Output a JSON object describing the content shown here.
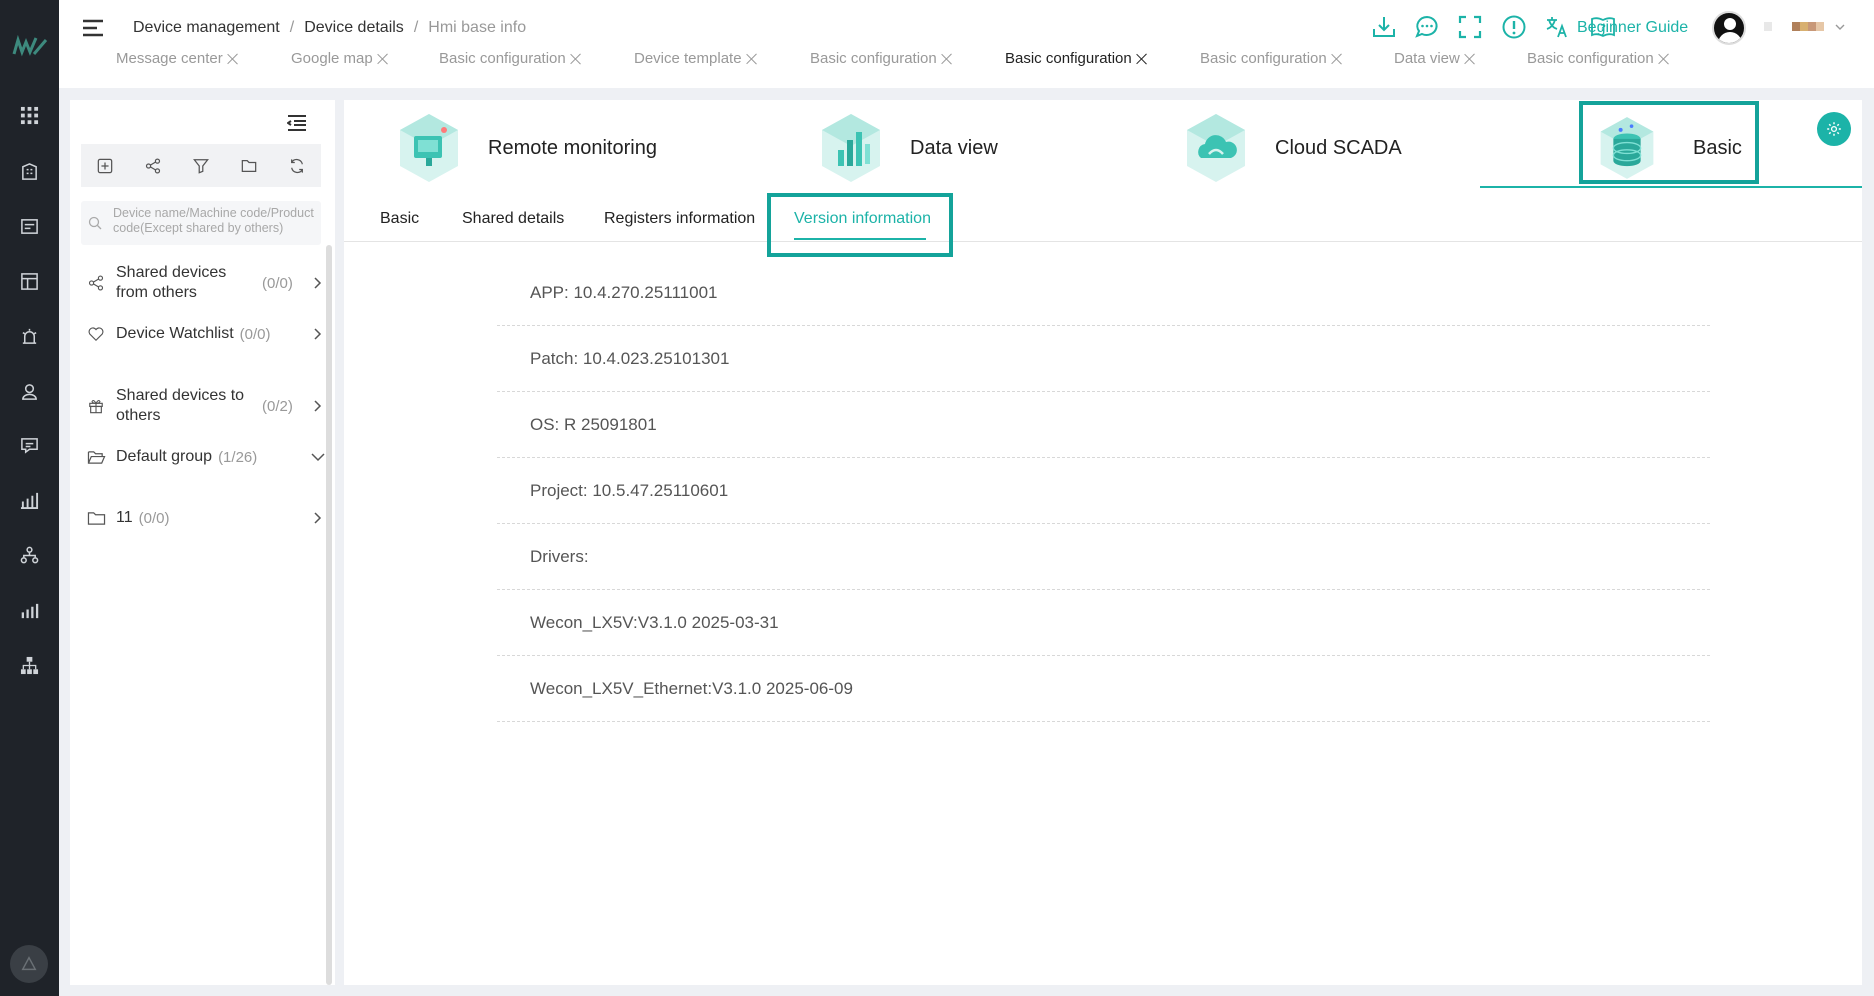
{
  "header": {
    "breadcrumb": [
      "Device management",
      "Device details",
      "Hmi base info"
    ],
    "tabs": [
      {
        "label": "Message center",
        "active": false
      },
      {
        "label": "Google map",
        "active": false
      },
      {
        "label": "Basic configuration",
        "active": false
      },
      {
        "label": "Device template",
        "active": false
      },
      {
        "label": "Basic configuration",
        "active": false
      },
      {
        "label": "Basic configuration",
        "active": true
      },
      {
        "label": "Basic configuration",
        "active": false
      },
      {
        "label": "Data view",
        "active": false
      },
      {
        "label": "Basic configuration",
        "active": false
      }
    ],
    "icons": [
      "download-icon",
      "chat-icon",
      "fullscreen-icon",
      "alert-icon",
      "translate-icon",
      "help-book-icon"
    ],
    "beginner_guide": "Beginner Guide",
    "accent_color": "#1cb3a8"
  },
  "rail": {
    "icons": [
      "apps-grid-icon",
      "building-icon",
      "card-icon",
      "layout-icon",
      "alarm-icon",
      "user-icon",
      "message-icon",
      "bar-chart-icon",
      "org-icon",
      "stats-icon",
      "sitemap-icon"
    ]
  },
  "sidebar": {
    "search_placeholder": "Device name/Machine code/Product code(Except shared by others)",
    "toolbar_icons": [
      "add-icon",
      "share-icon",
      "filter-icon",
      "folder-icon",
      "refresh-icon"
    ],
    "items": [
      {
        "label": "Shared devices from others",
        "count": "(0/0)",
        "icon": "share-icon"
      },
      {
        "label": "Device Watchlist",
        "count": "(0/0)",
        "icon": "heart-icon"
      },
      {
        "label": "Shared devices to others",
        "count": "(0/2)",
        "icon": "gift-icon"
      },
      {
        "label": "Default group",
        "count": "(1/26)",
        "icon": "folder-open-icon"
      },
      {
        "label": "11",
        "count": "(0/0)",
        "icon": "folder-icon"
      }
    ]
  },
  "modules": [
    {
      "label": "Remote monitoring"
    },
    {
      "label": "Data view"
    },
    {
      "label": "Cloud SCADA"
    },
    {
      "label": "Basic",
      "active": true
    }
  ],
  "subtabs": [
    {
      "label": "Basic"
    },
    {
      "label": "Shared details"
    },
    {
      "label": "Registers information"
    },
    {
      "label": "Version information",
      "active": true
    }
  ],
  "versions": [
    "APP: 10.4.270.25111001",
    "Patch: 10.4.023.25101301",
    "OS: R 25091801",
    "Project: 10.5.47.25110601",
    "Drivers:",
    "Wecon_LX5V:V3.1.0 2025-03-31",
    "Wecon_LX5V_Ethernet:V3.1.0 2025-06-09"
  ]
}
